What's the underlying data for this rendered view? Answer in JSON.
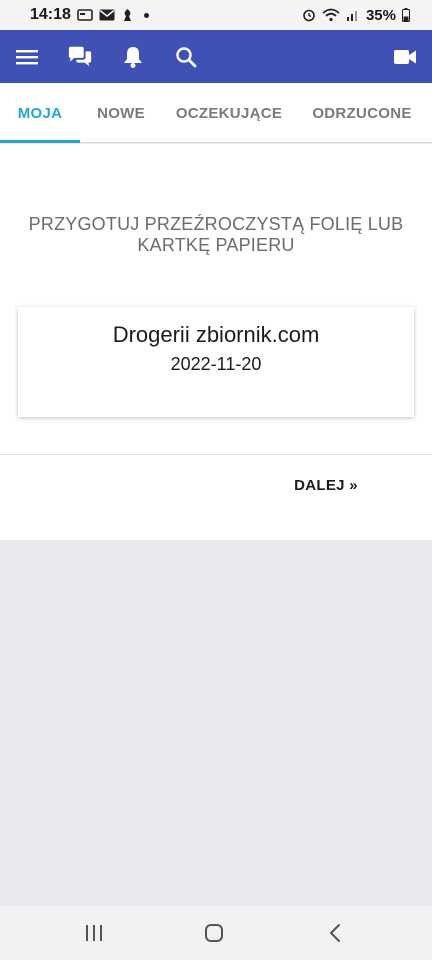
{
  "status_bar": {
    "time": "14:18",
    "battery": "35%"
  },
  "app_bar": {
    "color": "#3f51b5",
    "icons": [
      "menu-icon",
      "chat-icon",
      "bell-icon",
      "search-icon",
      "video-camera-icon"
    ]
  },
  "tabs": [
    {
      "label": "MOJA",
      "active": true
    },
    {
      "label": "NOWE",
      "active": false
    },
    {
      "label": "OCZEKUJĄCE",
      "active": false
    },
    {
      "label": "ODRZUCONE",
      "active": false
    }
  ],
  "main": {
    "instruction": "PRZYGOTUJ PRZEŹROCZYSTĄ FOLIĘ LUB KARTKĘ PAPIERU",
    "card": {
      "name": "Drogerii zbiornik.com",
      "date": "2022-11-20"
    },
    "next_label": "DALEJ »"
  },
  "colors": {
    "accent": "#27a3d6",
    "app_bar": "#3f51b5"
  }
}
